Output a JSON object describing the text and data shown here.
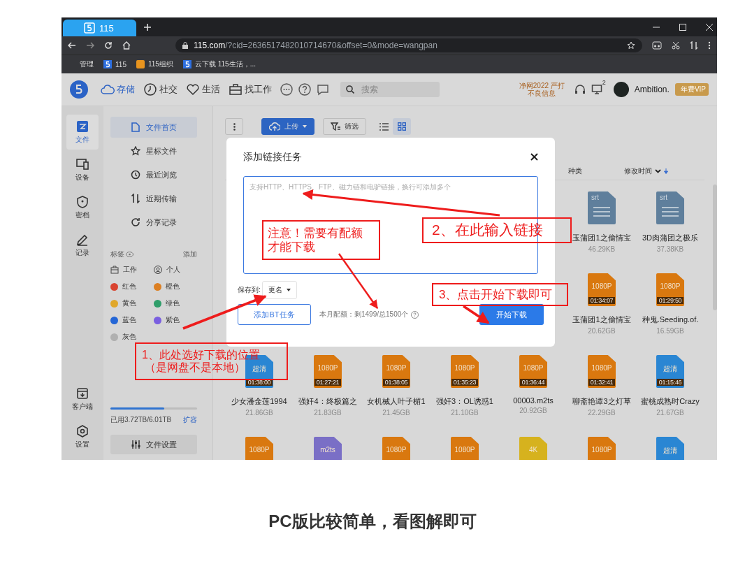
{
  "browser": {
    "tabs": [
      {
        "label": "115",
        "selected": true
      }
    ],
    "url_host": "115.com",
    "url_path": "/?cid=2636517482010714670&offset=0&mode=wangpan",
    "bookmarks": [
      {
        "label": "管理",
        "kind": "plain"
      },
      {
        "label": "115",
        "kind": "blue"
      },
      {
        "label": "115组织",
        "kind": "orange"
      },
      {
        "label": "云下载 115生活，...",
        "kind": "blue"
      }
    ]
  },
  "app": {
    "nav": [
      {
        "label": "存储",
        "kind": "cloud",
        "selected": true
      },
      {
        "label": "社交",
        "kind": "clock",
        "selected": false
      },
      {
        "label": "生活",
        "kind": "heart",
        "selected": false
      },
      {
        "label": "找工作",
        "kind": "briefcase",
        "selected": false
      }
    ],
    "search": {
      "placeholder": "搜索"
    },
    "notice": [
      "净网2022 严打",
      "不良信息"
    ],
    "monitor_badge": "2",
    "user": "Ambition.",
    "vip": "年费VIP"
  },
  "rail": {
    "top": [
      {
        "label": "文件",
        "kind": "files",
        "selected": true
      },
      {
        "label": "设备",
        "kind": "devices",
        "selected": false
      },
      {
        "label": "密档",
        "kind": "vault",
        "selected": false
      },
      {
        "label": "记录",
        "kind": "notes",
        "selected": false
      }
    ],
    "bottom": [
      {
        "label": "客户端",
        "kind": "client",
        "selected": false
      },
      {
        "label": "设置",
        "kind": "settings",
        "selected": false
      }
    ]
  },
  "sidebar": {
    "items": [
      {
        "label": "文件首页",
        "kind": "doc",
        "selected": true
      },
      {
        "label": "星标文件",
        "kind": "star",
        "selected": false
      },
      {
        "label": "最近浏览",
        "kind": "history",
        "selected": false
      },
      {
        "label": "近期传输",
        "kind": "transfer",
        "selected": false
      },
      {
        "label": "分享记录",
        "kind": "share",
        "selected": false
      }
    ],
    "tags_title": "标签",
    "tags_add": "添加",
    "tags": [
      {
        "label": "工作",
        "kind": "work"
      },
      {
        "label": "个人",
        "kind": "person"
      },
      {
        "label": "红色",
        "kind": "color",
        "color": "#d9432f"
      },
      {
        "label": "橙色",
        "kind": "color",
        "color": "#dc7f22"
      },
      {
        "label": "黄色",
        "kind": "color",
        "color": "#e0a72a"
      },
      {
        "label": "绿色",
        "kind": "color",
        "color": "#2f9e6a"
      },
      {
        "label": "蓝色",
        "kind": "color",
        "color": "#2466d6"
      },
      {
        "label": "紫色",
        "kind": "color",
        "color": "#7a5fe0"
      },
      {
        "label": "灰色",
        "kind": "color",
        "color": "#b0b0b0"
      }
    ],
    "storage": {
      "level": 0.62,
      "text": "已用3.72TB/6.01TB",
      "action": "扩容"
    },
    "settings": "文件设置"
  },
  "toolbar": {
    "upload": "上传",
    "filter": "筛选",
    "views": [
      {
        "kind": "list",
        "selected": false
      },
      {
        "kind": "grid",
        "selected": true
      }
    ]
  },
  "columns": [
    "种类",
    "修改时间"
  ],
  "rows": [
    [
      {
        "kind": "srt",
        "color": "#5f7f9c",
        "badge": "srt",
        "name": "玉蒲团1之偷情宝",
        "size": "46.29KB"
      },
      {
        "kind": "srt",
        "color": "#5f7f9c",
        "badge": "srt",
        "name": "3D肉蒲团之极乐",
        "size": "37.38KB"
      }
    ],
    [
      {
        "kind": "video",
        "color": "#d9780f",
        "badge": "1080P",
        "duration": "01:34:07",
        "name": "玉蒲团1之偷情宝",
        "size": "20.62GB"
      },
      {
        "kind": "video",
        "color": "#d9780f",
        "badge": "1080P",
        "duration": "01:29:50",
        "name": "种鬼.Seeding.of.",
        "size": "16.59GB"
      }
    ],
    [
      {
        "kind": "video",
        "color": "#2a86d3",
        "badge": "超清",
        "duration": "01:38:00",
        "name": "少女潘金莲1994",
        "size": "21.86GB"
      },
      {
        "kind": "video",
        "color": "#d9780f",
        "badge": "1080P",
        "duration": "01:27:21",
        "name": "强奸4：终极篇之",
        "size": "21.83GB"
      },
      {
        "kind": "video",
        "color": "#d9780f",
        "badge": "1080P",
        "duration": "01:38:05",
        "name": "女机械人叶子楣1",
        "size": "21.45GB"
      },
      {
        "kind": "video",
        "color": "#d9780f",
        "badge": "1080P",
        "duration": "01:35:23",
        "name": "强奸3：OL诱惑1",
        "size": "21.10GB"
      },
      {
        "kind": "video",
        "color": "#d9780f",
        "badge": "1080P",
        "duration": "01:36:44",
        "name": "00003.m2ts",
        "size": "20.92GB"
      },
      {
        "kind": "video",
        "color": "#d9780f",
        "badge": "1080P",
        "duration": "01:32:41",
        "name": "聊斋艳谭3之灯草",
        "size": "22.29GB"
      },
      {
        "kind": "video",
        "color": "#2a86d3",
        "badge": "超清",
        "duration": "01:15:46",
        "name": "蜜桃成熟时Crazy",
        "size": "21.67GB"
      }
    ],
    [
      {
        "kind": "video",
        "color": "#d9780f",
        "badge": "1080P"
      },
      {
        "kind": "video",
        "color": "#7a6fc6",
        "badge": "m2ts"
      },
      {
        "kind": "video",
        "color": "#d9780f",
        "badge": "1080P"
      },
      {
        "kind": "video",
        "color": "#d9780f",
        "badge": "1080P"
      },
      {
        "kind": "video",
        "color": "#d6b21e",
        "badge": "4K"
      },
      {
        "kind": "video",
        "color": "#d9780f",
        "badge": "1080P"
      },
      {
        "kind": "video",
        "color": "#2a86d3",
        "badge": "超清"
      }
    ]
  ],
  "dialog": {
    "title": "添加链接任务",
    "placeholder": "支持HTTP、HTTPS、FTP、磁力链和电驴链接，换行可添加多个",
    "save_label": "保存到:",
    "save_target": "更名",
    "bt_button": "添加BT任务",
    "quota": "本月配额：剩1499/总1500个",
    "start_button": "开始下载"
  },
  "notes": [
    {
      "lines": [
        "1、此处选好下载的位置",
        "（是网盘不是本地）"
      ]
    },
    {
      "lines": [
        "注意！需要有配额",
        "才能下载"
      ]
    },
    {
      "lines": [
        "2、在此输入链接"
      ]
    },
    {
      "lines": [
        "3、点击开始下载即可"
      ]
    }
  ],
  "caption": "PC版比较简单，看图解即可"
}
